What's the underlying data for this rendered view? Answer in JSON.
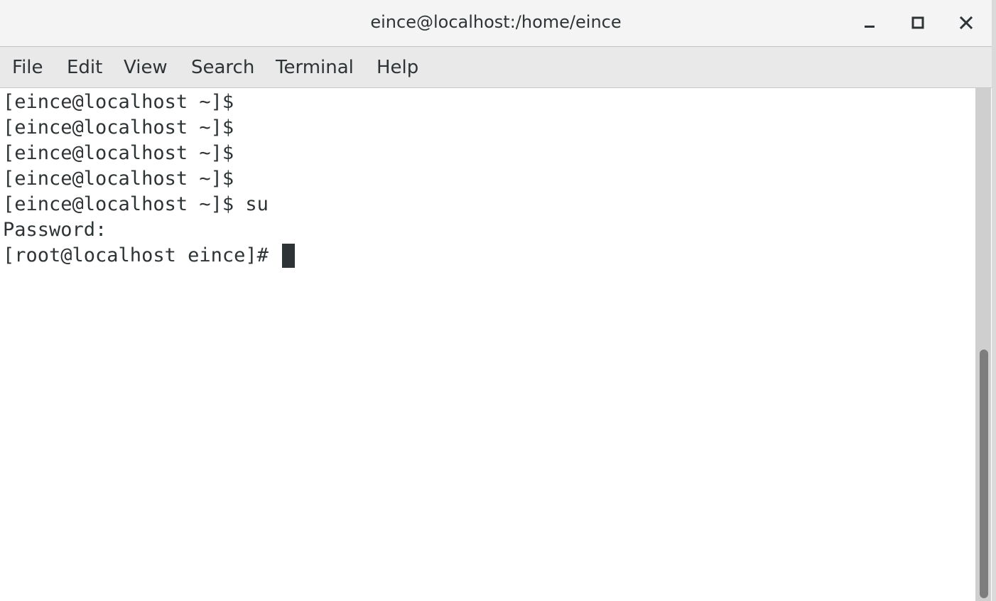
{
  "window": {
    "title": "eince@localhost:/home/eince",
    "controls": {
      "minimize": "minimize-icon",
      "maximize": "maximize-icon",
      "close": "close-icon"
    }
  },
  "menu": {
    "items": [
      {
        "label": "File"
      },
      {
        "label": "Edit"
      },
      {
        "label": "View"
      },
      {
        "label": "Search"
      },
      {
        "label": "Terminal"
      },
      {
        "label": "Help"
      }
    ]
  },
  "terminal": {
    "lines": [
      "[eince@localhost ~]$",
      "[eince@localhost ~]$",
      "[eince@localhost ~]$",
      "[eince@localhost ~]$",
      "[eince@localhost ~]$ su",
      "Password:",
      "[root@localhost eince]# "
    ]
  },
  "colors": {
    "text": "#2e3436",
    "titlebar": "#f4f4f4",
    "menubar": "#e9e9e9",
    "scroll_thumb": "#7d7d7d"
  }
}
